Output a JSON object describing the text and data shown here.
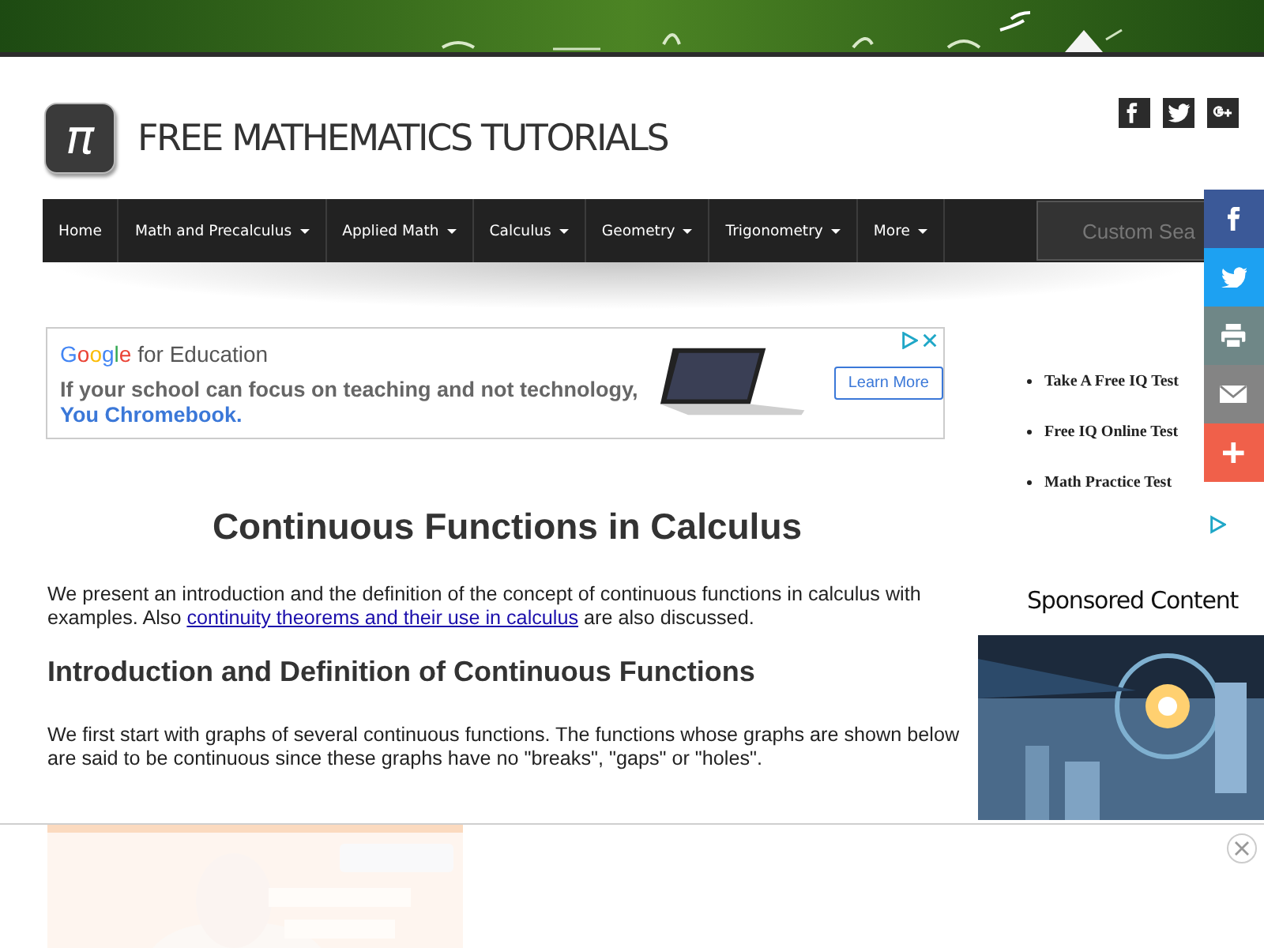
{
  "header": {
    "logo": "π",
    "title": "FREE MATHEMATICS TUTORIALS",
    "social": [
      {
        "kind": "facebook"
      },
      {
        "kind": "twitter"
      },
      {
        "kind": "googleplus"
      }
    ]
  },
  "nav": {
    "items": [
      {
        "label": "Home",
        "dropdown": false
      },
      {
        "label": "Math and Precalculus",
        "dropdown": true
      },
      {
        "label": "Applied Math",
        "dropdown": true
      },
      {
        "label": "Calculus",
        "dropdown": true
      },
      {
        "label": "Geometry",
        "dropdown": true
      },
      {
        "label": "Trigonometry",
        "dropdown": true
      },
      {
        "label": "More",
        "dropdown": true
      }
    ],
    "search": {
      "placeholder": "Custom Sea"
    }
  },
  "share": [
    {
      "kind": "facebook",
      "color": "#3b5998"
    },
    {
      "kind": "twitter",
      "color": "#1da1f2"
    },
    {
      "kind": "print",
      "color": "#6f8787"
    },
    {
      "kind": "email",
      "color": "#848484"
    },
    {
      "kind": "more",
      "color": "#f0604a"
    }
  ],
  "ad": {
    "brand": "Google",
    "brand_suffix": "for Education",
    "headline": "If your school can focus on teaching and not technology,",
    "tagline": "You Chromebook.",
    "button": "Learn More"
  },
  "article": {
    "title": "Continuous Functions in Calculus",
    "intro_before": "We present an introduction and the definition of the concept of continuous functions in calculus with examples. Also ",
    "intro_link": "continuity theorems and their use in calculus",
    "intro_after": " are also discussed.",
    "heading": "Introduction and Definition of Continuous Functions",
    "paragraph": "We first start with graphs of several continuous functions. The functions whose graphs are shown below are said to be continuous since these graphs have no \"breaks\", \"gaps\" or \"holes\"."
  },
  "sidebar": {
    "links": [
      "Take A Free IQ Test",
      "Free IQ Online Test",
      "Math Practice Test"
    ],
    "sponsored_heading": "Sponsored Content"
  }
}
